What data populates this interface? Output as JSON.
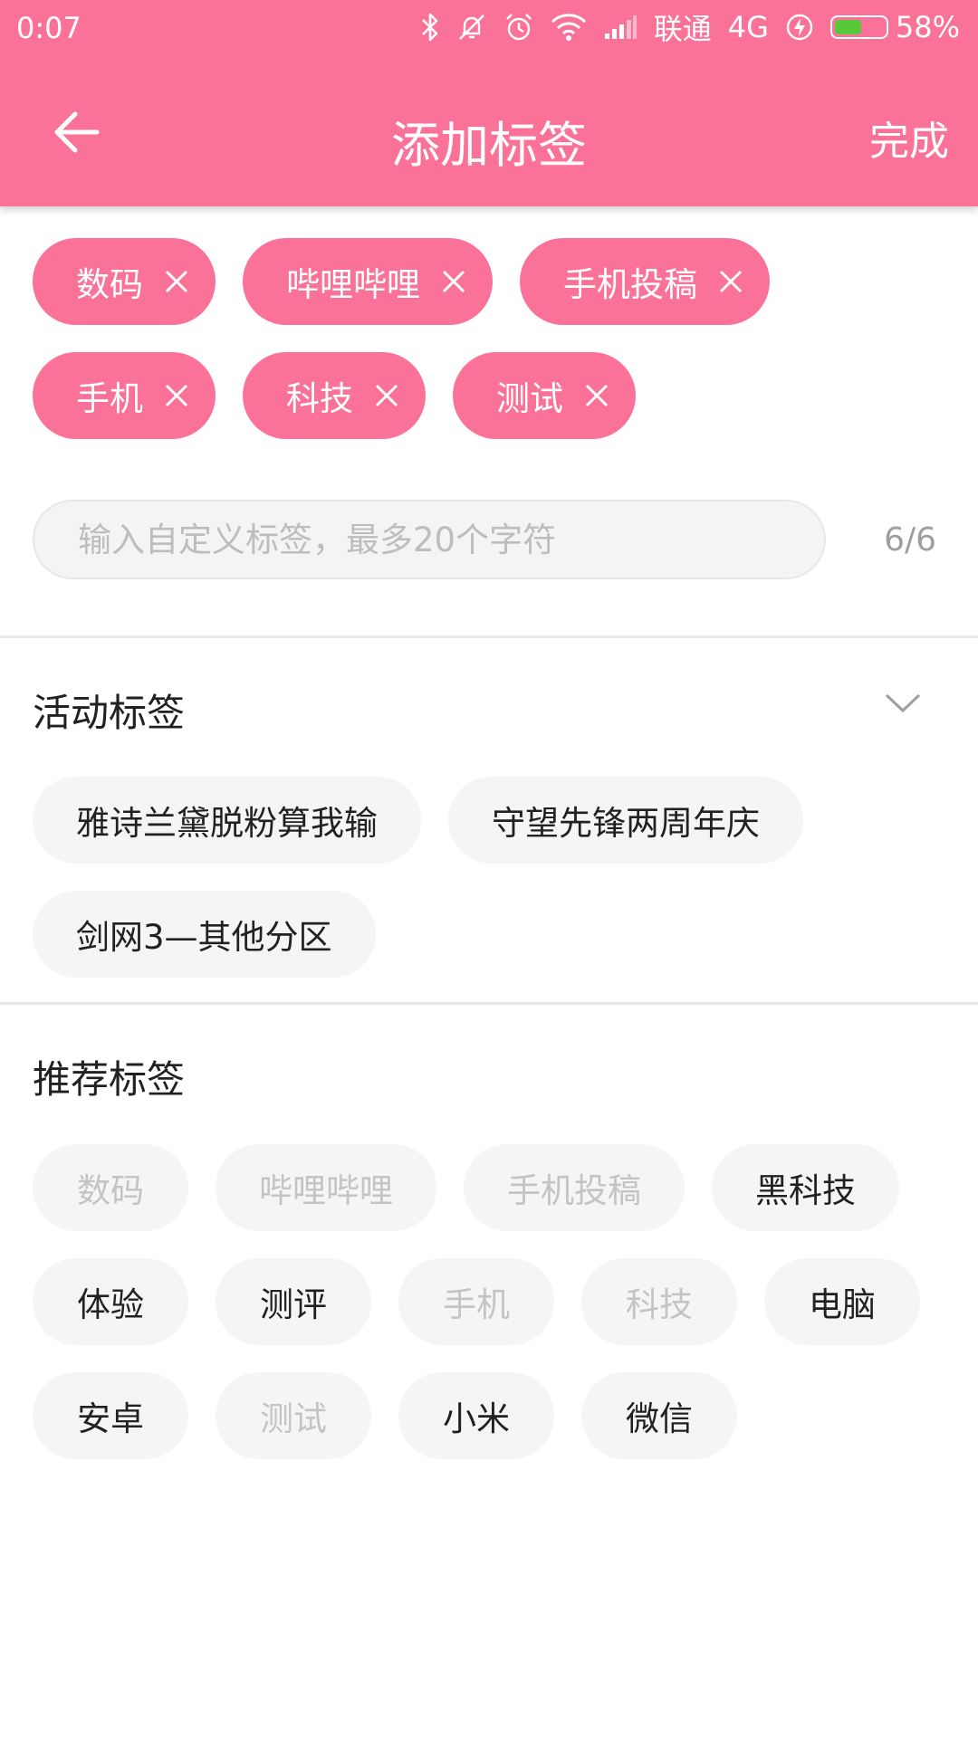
{
  "status": {
    "time": "0:07",
    "carrier": "联通",
    "network": "4G",
    "battery": "58%",
    "battery_level": 0.58
  },
  "header": {
    "title": "添加标签",
    "done_label": "完成",
    "back_icon": "arrow-left-icon"
  },
  "selected_tags": [
    {
      "label": "数码"
    },
    {
      "label": "哔哩哔哩"
    },
    {
      "label": "手机投稿"
    },
    {
      "label": "手机"
    },
    {
      "label": "科技"
    },
    {
      "label": "测试"
    }
  ],
  "input": {
    "placeholder": "输入自定义标签，最多20个字符",
    "value": "",
    "counter": "6/6"
  },
  "activity": {
    "title": "活动标签",
    "tags": [
      {
        "label": "雅诗兰黛脱粉算我输"
      },
      {
        "label": "守望先锋两周年庆"
      },
      {
        "label": "剑网3—其他分区"
      }
    ]
  },
  "recommended": {
    "title": "推荐标签",
    "tags": [
      {
        "label": "数码",
        "disabled": true
      },
      {
        "label": "哔哩哔哩",
        "disabled": true
      },
      {
        "label": "手机投稿",
        "disabled": true
      },
      {
        "label": "黑科技",
        "disabled": false
      },
      {
        "label": "体验",
        "disabled": false
      },
      {
        "label": "测评",
        "disabled": false
      },
      {
        "label": "手机",
        "disabled": true
      },
      {
        "label": "科技",
        "disabled": true
      },
      {
        "label": "电脑",
        "disabled": false
      },
      {
        "label": "安卓",
        "disabled": false
      },
      {
        "label": "测试",
        "disabled": true
      },
      {
        "label": "小米",
        "disabled": false
      },
      {
        "label": "微信",
        "disabled": false
      }
    ]
  },
  "colors": {
    "accent": "#fb7299",
    "tag_bg": "#f4f5f7",
    "disabled_text": "#c4c4c4",
    "battery_fill": "#59c73a"
  }
}
